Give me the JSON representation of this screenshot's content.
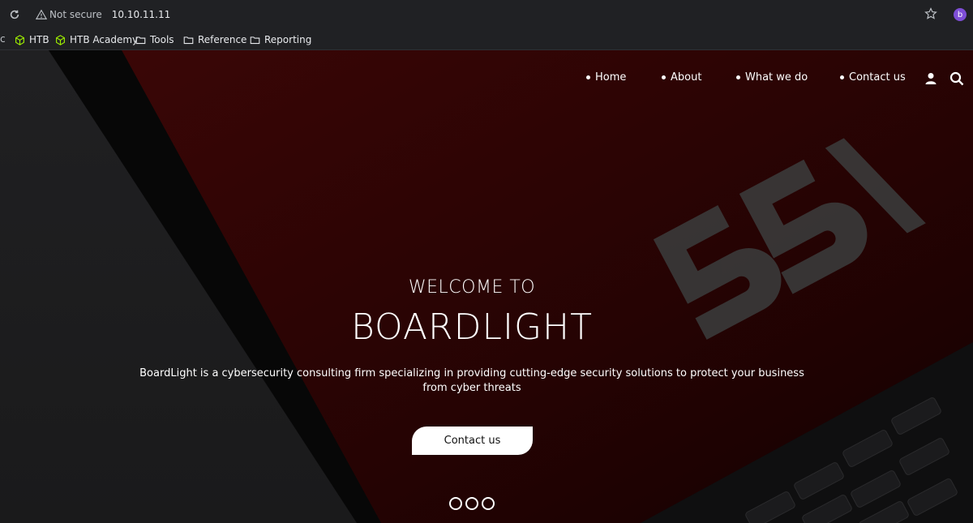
{
  "browser": {
    "security_label": "Not secure",
    "host": "10.10.11.11",
    "profile_initial": "b",
    "bookmarks_cut": "c",
    "bookmarks": [
      {
        "label": "HTB",
        "icon": "htb-cube-icon"
      },
      {
        "label": "HTB Academy",
        "icon": "htb-cube-icon"
      },
      {
        "label": "Tools",
        "icon": "folder-icon"
      },
      {
        "label": "Reference",
        "icon": "folder-icon"
      },
      {
        "label": "Reporting",
        "icon": "folder-icon"
      }
    ],
    "colors": {
      "chrome": "#202124",
      "htb_green": "#9fef00",
      "profile": "#7e4ed6"
    }
  },
  "site": {
    "nav": {
      "items": [
        "Home",
        "About",
        "What we do",
        "Contact us"
      ],
      "icons": [
        "user-icon",
        "search-icon"
      ]
    },
    "hero": {
      "welcome": "WELCOME TO",
      "brand": "BOARDLIGHT",
      "description": "BoardLight is a cybersecurity consulting firm specializing in providing cutting-edge security solutions to protect your business from cyber threats",
      "cta": "Contact us",
      "slides": 3,
      "colors": {
        "accent": "#2a0505",
        "text": "#ffffff"
      }
    }
  }
}
